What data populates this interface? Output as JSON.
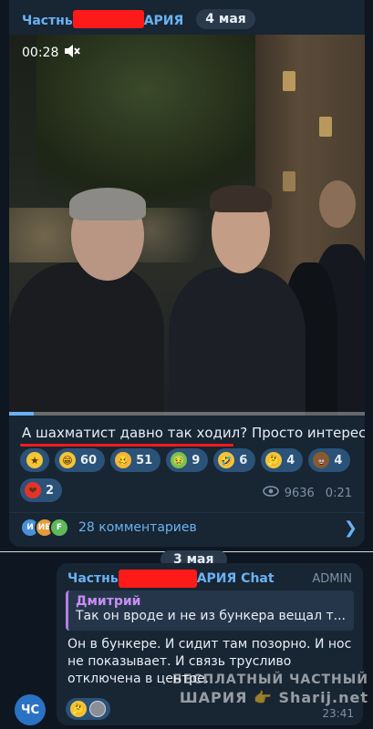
{
  "post": {
    "channel_prefix": "Частнь",
    "channel_suffix": "АРИЯ",
    "date": "4 мая",
    "video": {
      "elapsed": "00:28",
      "progress_fraction": 0.07
    },
    "caption": "А шахматист давно так ходил? Просто интересно",
    "reactions": [
      {
        "icon": "star-icon",
        "color": "#f5c43a",
        "glyph": "★",
        "count": ""
      },
      {
        "icon": "laughing-face-icon",
        "color": "#f5c43a",
        "glyph": "😁",
        "count": "60"
      },
      {
        "icon": "woozy-face-icon",
        "color": "#f5b53a",
        "glyph": "🥴",
        "count": "51"
      },
      {
        "icon": "nauseated-face-icon",
        "color": "#7cc246",
        "glyph": "🤢",
        "count": "9"
      },
      {
        "icon": "rofl-face-icon",
        "color": "#f5c43a",
        "glyph": "🤣",
        "count": "6"
      },
      {
        "icon": "thinking-face-icon",
        "color": "#f5c43a",
        "glyph": "🤔",
        "count": "4"
      },
      {
        "icon": "poop-icon",
        "color": "#8a5a2b",
        "glyph": "💩",
        "count": "4"
      },
      {
        "icon": "heart-icon",
        "color": "#e5322d",
        "glyph": "❤",
        "count": "2"
      }
    ],
    "views": "9636",
    "time": "0:21",
    "commenters": [
      {
        "initials": "И",
        "color": "#4a90d9"
      },
      {
        "initials": "ИБ",
        "color": "#e69b3a"
      },
      {
        "initials": "F",
        "color": "#5fb85c"
      }
    ],
    "comments_label": "28 комментариев"
  },
  "divider_date": "3 мая",
  "comment": {
    "author_prefix": "Частнь",
    "author_suffix": "АРИЯ Chat",
    "role": "ADMIN",
    "reply_to": {
      "name": "Дмитрий",
      "text": "Так он вроде и не из бункера вещал т..."
    },
    "lines": [
      "Он в бункере. И сидит там позорно. И нос",
      "не показывает. И связь трусливо",
      "отключена в центре."
    ],
    "time": "23:41",
    "avatar_initials": "ЧС",
    "reactions": [
      {
        "icon": "thinking-face-icon",
        "color": "#f5c43a",
        "glyph": "🤔"
      },
      {
        "icon": "user-avatar-icon",
        "color": "#8a8f96",
        "glyph": ""
      }
    ]
  },
  "watermark": {
    "line1": "БЕСПЛАТНЫЙ ЧАСТНЫЙ",
    "line2": "ШАРИЯ 👉 Sharij.net"
  }
}
